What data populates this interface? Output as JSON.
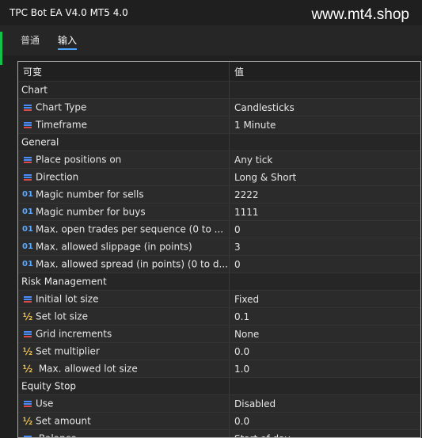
{
  "window": {
    "title": "TPC Bot EA V4.0 MT5 4.0",
    "watermark": "www.mt4.shop"
  },
  "tabs": [
    {
      "label": "普通"
    },
    {
      "label": "输入",
      "active": true
    }
  ],
  "table": {
    "headers": [
      "可变",
      "值"
    ],
    "rows": [
      {
        "kind": "group",
        "name": "Chart",
        "value": ""
      },
      {
        "kind": "param",
        "icon": "enum",
        "name": "Chart Type",
        "value": "Candlesticks"
      },
      {
        "kind": "param",
        "icon": "enum",
        "name": "Timeframe",
        "value": "1 Minute"
      },
      {
        "kind": "group",
        "name": "General",
        "value": ""
      },
      {
        "kind": "param",
        "icon": "enum",
        "name": "Place positions on",
        "value": "Any tick"
      },
      {
        "kind": "param",
        "icon": "enum",
        "name": "Direction",
        "value": "Long & Short"
      },
      {
        "kind": "param",
        "icon": "int",
        "name": "Magic number for sells",
        "value": "2222"
      },
      {
        "kind": "param",
        "icon": "int",
        "name": "Magic number for buys",
        "value": "1111"
      },
      {
        "kind": "param",
        "icon": "int",
        "name": "Max. open trades per sequence (0 to ...",
        "value": "0"
      },
      {
        "kind": "param",
        "icon": "int",
        "name": "Max. allowed slippage (in points)",
        "value": "3"
      },
      {
        "kind": "param",
        "icon": "int",
        "name": "Max. allowed spread (in points) (0 to d...",
        "value": "0"
      },
      {
        "kind": "group",
        "name": "Risk Management",
        "value": ""
      },
      {
        "kind": "param",
        "icon": "enum",
        "name": "Initial lot size",
        "value": "Fixed"
      },
      {
        "kind": "param",
        "icon": "double",
        "name": "Set lot size",
        "value": "0.1"
      },
      {
        "kind": "param",
        "icon": "enum",
        "name": "Grid increments",
        "value": "None"
      },
      {
        "kind": "param",
        "icon": "double",
        "name": "Set multiplier",
        "value": "0.0"
      },
      {
        "kind": "param",
        "icon": "double",
        "name": "  Max. allowed lot size",
        "value": "1.0"
      },
      {
        "kind": "group",
        "name": "Equity Stop",
        "value": ""
      },
      {
        "kind": "param",
        "icon": "enum",
        "name": "Use",
        "value": "Disabled"
      },
      {
        "kind": "param",
        "icon": "double",
        "name": "Set amount",
        "value": "0.0"
      },
      {
        "kind": "param",
        "icon": "enum",
        "name": "  Balance",
        "value": "Start of day"
      }
    ]
  },
  "icons": {
    "enum": "list-enum-icon",
    "int": "integer-type-icon",
    "double": "double-type-icon"
  },
  "icon_glyphs": {
    "int": "01",
    "double": "½"
  }
}
